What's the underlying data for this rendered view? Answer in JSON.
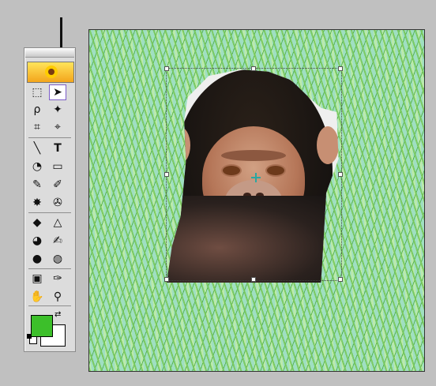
{
  "app": {
    "fg_color": "#3cbf2a",
    "bg_color": "#ffffff",
    "selected_tool": "pick-tool"
  },
  "toolbox": {
    "tools": [
      {
        "name": "rectangle-marquee-tool-icon",
        "glyph": "⬚"
      },
      {
        "name": "pick-tool-icon",
        "glyph": "➤"
      },
      {
        "name": "lasso-tool-icon",
        "glyph": "ρ"
      },
      {
        "name": "magic-wand-tool-icon",
        "glyph": "✦"
      },
      {
        "name": "crop-tool-icon",
        "glyph": "⌗"
      },
      {
        "name": "transform-tool-icon",
        "glyph": "⌖"
      },
      {
        "name": "line-tool-icon",
        "glyph": "╲"
      },
      {
        "name": "text-tool-icon",
        "glyph": "T"
      },
      {
        "name": "paint-bucket-tool-icon",
        "glyph": "◔"
      },
      {
        "name": "gradient-tool-icon",
        "glyph": "▭"
      },
      {
        "name": "brush-tool-icon",
        "glyph": "✎"
      },
      {
        "name": "pencil-tool-icon",
        "glyph": "✐"
      },
      {
        "name": "eraser-tool-icon",
        "glyph": "✸"
      },
      {
        "name": "clone-tool-icon",
        "glyph": "✇"
      },
      {
        "name": "blur-tool-icon",
        "glyph": "◆"
      },
      {
        "name": "sharpen-tool-icon",
        "glyph": "△"
      },
      {
        "name": "smudge-tool-icon",
        "glyph": "◕"
      },
      {
        "name": "dodge-tool-icon",
        "glyph": "✍"
      },
      {
        "name": "burn-tool-icon",
        "glyph": "●"
      },
      {
        "name": "sponge-tool-icon",
        "glyph": "◍"
      },
      {
        "name": "stamp-tool-icon",
        "glyph": "▣"
      },
      {
        "name": "eyedropper-tool-icon",
        "glyph": "✑"
      },
      {
        "name": "hand-tool-icon",
        "glyph": "✋"
      },
      {
        "name": "zoom-tool-icon",
        "glyph": "⚲"
      }
    ]
  }
}
